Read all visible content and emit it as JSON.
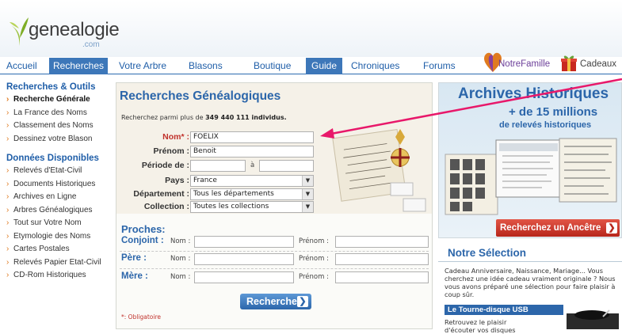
{
  "brand": {
    "name": "genealogie",
    "sub": ".com"
  },
  "nav": {
    "items": [
      "Accueil",
      "Recherches",
      "Votre Arbre",
      "Blasons",
      "Boutique",
      "Guide",
      "Chroniques",
      "Forums"
    ],
    "notrefamille": "NotreFamille",
    "cadeaux": "Cadeaux"
  },
  "sidebar": {
    "section1_title": "Recherches & Outils",
    "section1_items": [
      "Recherche Générale",
      "La France des Noms",
      "Classement des Noms",
      "Dessinez votre Blason"
    ],
    "section2_title": "Données Disponibles",
    "section2_items": [
      "Relevés d'Etat-Civil",
      "Documents Historiques",
      "Archives en Ligne",
      "Arbres Généalogiques",
      "Tout sur Votre Nom",
      "Etymologie des Noms",
      "Cartes Postales",
      "Relevés Papier Etat-Civil",
      "CD-Rom Historiques"
    ]
  },
  "search": {
    "title": "Recherches Généalogiques",
    "subtitle_prefix": "Recherchez parmi plus de ",
    "subtitle_count": "349 440 111 individus.",
    "nom_label": "Nom",
    "nom_star": "* :",
    "nom_value": "FOELIX",
    "prenom_label": "Prénom :",
    "prenom_value": "Benoit",
    "periode_label": "Période de :",
    "periode_sep": "à",
    "pays_label": "Pays :",
    "pays_value": "France",
    "departement_label": "Département :",
    "departement_value": "Tous les départements",
    "collection_label": "Collection :",
    "collection_value": "Toutes les collections",
    "proches_title": "Proches:",
    "conjoint_label": "Conjoint :",
    "pere_label": "Père :",
    "mere_label": "Mère :",
    "nom_small": "Nom :",
    "prenom_small": "Prénom :",
    "submit_label": "Rechercher",
    "obligatoire": "*: Obligatoire"
  },
  "archives": {
    "title": "Archives Historiques",
    "sub1": "+ de 15 millions",
    "sub2": "de relevés historiques",
    "button": "Recherchez un Ancêtre"
  },
  "selection": {
    "title": "Notre Sélection",
    "text": "Cadeau Anniversaire, Naissance, Mariage... Vous cherchez une idée cadeau vraiment originale ? Nous vous avons préparé une sélection pour faire plaisir à coup sûr.",
    "product_title": "Le Tourne-disque USB",
    "product_text": "Retrouvez le plaisir d'écouter vos disques"
  },
  "colors": {
    "brand_blue": "#2c66aa",
    "nav_active": "#3d77b9",
    "accent_red": "#c0312b",
    "annotation_arrow": "#e8186a"
  }
}
